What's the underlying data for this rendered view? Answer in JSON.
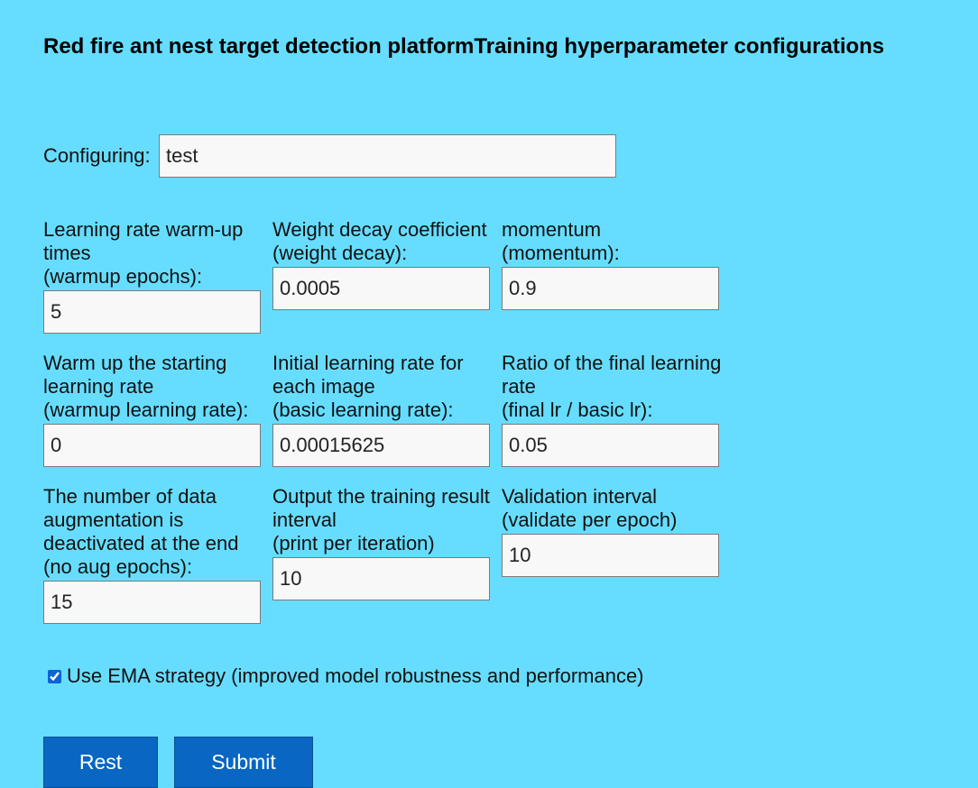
{
  "title": "Red fire ant nest target detection platformTraining hyperparameter configurations",
  "configuring": {
    "label": "Configuring:",
    "value": "test"
  },
  "fields": {
    "warmup_epochs": {
      "label_lines": [
        "Learning rate warm-up",
        "times",
        "(warmup epochs):"
      ],
      "value": "5"
    },
    "weight_decay": {
      "label_lines": [
        "Weight decay coefficient",
        "(weight decay):"
      ],
      "value": "0.0005"
    },
    "momentum": {
      "label_lines": [
        "momentum",
        "(momentum):"
      ],
      "value": "0.9"
    },
    "warmup_lr": {
      "label_lines": [
        "Warm up the starting",
        "learning rate",
        "(warmup learning rate):"
      ],
      "value": "0"
    },
    "basic_lr": {
      "label_lines": [
        "Initial learning rate for",
        "each image",
        "(basic learning rate):"
      ],
      "value": "0.00015625"
    },
    "final_lr_ratio": {
      "label_lines": [
        "Ratio of the final learning",
        "rate",
        "(final lr / basic lr):"
      ],
      "value": "0.05"
    },
    "no_aug_epochs": {
      "label_lines": [
        "The number of data",
        "augmentation is",
        "deactivated at the end",
        "(no aug epochs):"
      ],
      "value": "15"
    },
    "print_interval": {
      "label_lines": [
        "Output the training result",
        "interval",
        "(print per iteration)"
      ],
      "value": "10"
    },
    "eval_interval": {
      "label_lines": [
        "Validation interval",
        "(validate per epoch)"
      ],
      "value": "10"
    }
  },
  "ema": {
    "label": "Use EMA strategy (improved model robustness and performance)",
    "checked": true
  },
  "buttons": {
    "reset_label": "Rest",
    "submit_label": "Submit"
  },
  "colors": {
    "background": "#66ddff",
    "button": "#0966c2"
  }
}
